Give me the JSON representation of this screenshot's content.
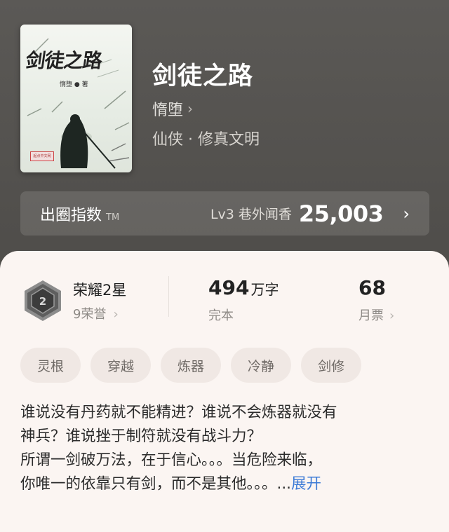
{
  "book": {
    "cover_title": "剑徒之路",
    "cover_author": "惰堕 ● 著",
    "cover_publisher": "起点中文网",
    "title": "剑徒之路",
    "author": "惰堕",
    "genre": "仙侠 · 修真文明"
  },
  "index_bar": {
    "label": "出圈指数",
    "tm": "TM",
    "level": "Lv3 巷外闻香",
    "score": "25,003"
  },
  "stats": {
    "honor_title": "荣耀2星",
    "honor_sub": "9荣誉",
    "words_num": "494",
    "words_unit": "万字",
    "status": "完本",
    "votes_num": "68",
    "votes_label": "月票"
  },
  "tags": [
    "灵根",
    "穿越",
    "炼器",
    "冷静",
    "剑修"
  ],
  "description": {
    "line1": "谁说没有丹药就不能精进？谁说不会炼器就没有",
    "line2": "神兵？谁说挫于制符就没有战斗力？",
    "line3": "所谓一剑破万法，在于信心。。。当危险来临，",
    "line4": "你唯一的依靠只有剑，而不是其他。。。...",
    "expand": "展开"
  },
  "colors": {
    "accent_link": "#3d7bd6",
    "panel_bg": "#fbf5f2",
    "tag_bg": "#f0e8e4"
  }
}
